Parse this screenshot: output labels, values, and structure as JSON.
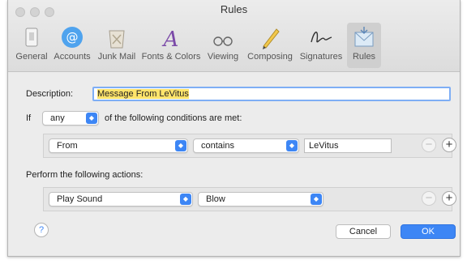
{
  "window": {
    "title": "Rules"
  },
  "toolbar": {
    "items": [
      {
        "label": "General",
        "icon": "general-icon"
      },
      {
        "label": "Accounts",
        "icon": "at-sign-icon"
      },
      {
        "label": "Junk Mail",
        "icon": "trash-junk-icon"
      },
      {
        "label": "Fonts & Colors",
        "icon": "font-a-icon"
      },
      {
        "label": "Viewing",
        "icon": "glasses-icon"
      },
      {
        "label": "Composing",
        "icon": "pencil-icon"
      },
      {
        "label": "Signatures",
        "icon": "signature-icon"
      },
      {
        "label": "Rules",
        "icon": "envelope-rules-icon",
        "active": true
      }
    ]
  },
  "rule": {
    "description_label": "Description:",
    "description_value": "Message From LeVitus",
    "if_label": "If",
    "match_select": "any",
    "conditions_text": "of the following conditions are met:",
    "condition": {
      "field": "From",
      "operator": "contains",
      "value": "LeVitus"
    },
    "actions_label": "Perform the following actions:",
    "action": {
      "type": "Play Sound",
      "sound": "Blow"
    }
  },
  "buttons": {
    "help": "?",
    "cancel": "Cancel",
    "ok": "OK",
    "add": "+",
    "remove": "−"
  },
  "colors": {
    "accent": "#3d86f5",
    "highlight": "#ffe46b"
  }
}
